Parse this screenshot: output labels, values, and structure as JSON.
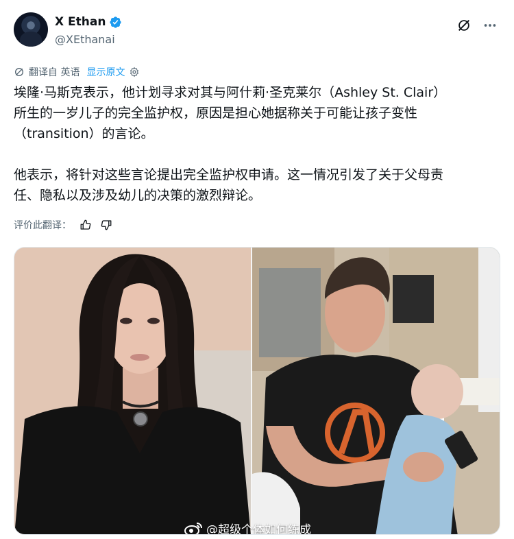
{
  "user": {
    "display_name": "X Ethan",
    "handle": "@XEthanai",
    "verified": true,
    "verified_color": "#1d9bf0"
  },
  "header_icons": [
    "grok-icon",
    "more-icon"
  ],
  "translation": {
    "label": "翻译自 英语",
    "show_original": "显示原文",
    "icon": "translate-icon",
    "settings_icon": "gear-icon"
  },
  "tweet": {
    "paragraph1_line1": "埃隆·马斯克表示，他计划寻求对其与阿什莉·圣克莱尔（Ashley St. Clair）",
    "paragraph1_line2": "所生的一岁儿子的完全监护权，原因是担心她据称关于可能让孩子变性",
    "paragraph1_line3": "（transition）的言论。",
    "paragraph2_line1": "他表示，将针对这些言论提出完全监护权申请。这一情况引发了关于父母责",
    "paragraph2_line2": "任、隐私以及涉及幼儿的决策的激烈辩论。"
  },
  "rate": {
    "label": "评价此翻译：",
    "like_icon": "thumbs-up-icon",
    "dislike_icon": "thumbs-down-icon"
  },
  "media": {
    "watermark": "@超级个体如何练成",
    "watermark_icon": "weibo-icon"
  },
  "colors": {
    "text": "#0f1419",
    "secondary": "#536471",
    "accent": "#1d9bf0"
  }
}
